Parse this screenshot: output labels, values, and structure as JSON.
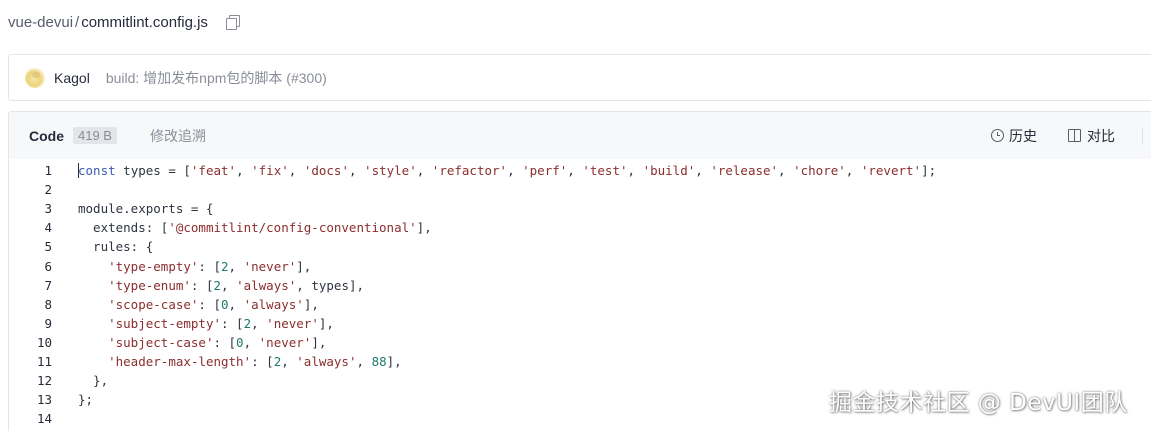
{
  "breadcrumb": {
    "repo": "vue-devui",
    "separator": "/",
    "file": "commitlint.config.js",
    "copy_icon": "copy-icon"
  },
  "commit": {
    "avatar_icon": "avatar-image",
    "author": "Kagol",
    "message": "build: 增加发布npm包的脚本 (#300)"
  },
  "file_header": {
    "tab_code": "Code",
    "size": "419 B",
    "tab_blame": "修改追溯",
    "history_label": "历史",
    "history_icon": "clock-icon",
    "compare_label": "对比",
    "compare_icon": "compare-icon"
  },
  "code": {
    "lines": [
      {
        "n": "1",
        "tokens": [
          [
            "kw",
            "const"
          ],
          [
            "p",
            " types = ["
          ],
          [
            "s",
            "'feat'"
          ],
          [
            "p",
            ", "
          ],
          [
            "s",
            "'fix'"
          ],
          [
            "p",
            ", "
          ],
          [
            "s",
            "'docs'"
          ],
          [
            "p",
            ", "
          ],
          [
            "s",
            "'style'"
          ],
          [
            "p",
            ", "
          ],
          [
            "s",
            "'refactor'"
          ],
          [
            "p",
            ", "
          ],
          [
            "s",
            "'perf'"
          ],
          [
            "p",
            ", "
          ],
          [
            "s",
            "'test'"
          ],
          [
            "p",
            ", "
          ],
          [
            "s",
            "'build'"
          ],
          [
            "p",
            ", "
          ],
          [
            "s",
            "'release'"
          ],
          [
            "p",
            ", "
          ],
          [
            "s",
            "'chore'"
          ],
          [
            "p",
            ", "
          ],
          [
            "s",
            "'revert'"
          ],
          [
            "p",
            "];"
          ]
        ]
      },
      {
        "n": "2",
        "tokens": []
      },
      {
        "n": "3",
        "tokens": [
          [
            "p",
            "module.exports = {"
          ]
        ]
      },
      {
        "n": "4",
        "tokens": [
          [
            "p",
            "  extends: ["
          ],
          [
            "s",
            "'@commitlint/config-conventional'"
          ],
          [
            "p",
            "],"
          ]
        ]
      },
      {
        "n": "5",
        "tokens": [
          [
            "p",
            "  rules: {"
          ]
        ]
      },
      {
        "n": "6",
        "tokens": [
          [
            "p",
            "    "
          ],
          [
            "s",
            "'type-empty'"
          ],
          [
            "p",
            ": ["
          ],
          [
            "n",
            "2"
          ],
          [
            "p",
            ", "
          ],
          [
            "s",
            "'never'"
          ],
          [
            "p",
            "],"
          ]
        ]
      },
      {
        "n": "7",
        "tokens": [
          [
            "p",
            "    "
          ],
          [
            "s",
            "'type-enum'"
          ],
          [
            "p",
            ": ["
          ],
          [
            "n",
            "2"
          ],
          [
            "p",
            ", "
          ],
          [
            "s",
            "'always'"
          ],
          [
            "p",
            ", types],"
          ]
        ]
      },
      {
        "n": "8",
        "tokens": [
          [
            "p",
            "    "
          ],
          [
            "s",
            "'scope-case'"
          ],
          [
            "p",
            ": ["
          ],
          [
            "n",
            "0"
          ],
          [
            "p",
            ", "
          ],
          [
            "s",
            "'always'"
          ],
          [
            "p",
            "],"
          ]
        ]
      },
      {
        "n": "9",
        "tokens": [
          [
            "p",
            "    "
          ],
          [
            "s",
            "'subject-empty'"
          ],
          [
            "p",
            ": ["
          ],
          [
            "n",
            "2"
          ],
          [
            "p",
            ", "
          ],
          [
            "s",
            "'never'"
          ],
          [
            "p",
            "],"
          ]
        ]
      },
      {
        "n": "10",
        "tokens": [
          [
            "p",
            "    "
          ],
          [
            "s",
            "'subject-case'"
          ],
          [
            "p",
            ": ["
          ],
          [
            "n",
            "0"
          ],
          [
            "p",
            ", "
          ],
          [
            "s",
            "'never'"
          ],
          [
            "p",
            "],"
          ]
        ]
      },
      {
        "n": "11",
        "tokens": [
          [
            "p",
            "    "
          ],
          [
            "s",
            "'header-max-length'"
          ],
          [
            "p",
            ": ["
          ],
          [
            "n",
            "2"
          ],
          [
            "p",
            ", "
          ],
          [
            "s",
            "'always'"
          ],
          [
            "p",
            ", "
          ],
          [
            "n",
            "88"
          ],
          [
            "p",
            "],"
          ]
        ]
      },
      {
        "n": "12",
        "tokens": [
          [
            "p",
            "  },"
          ]
        ]
      },
      {
        "n": "13",
        "tokens": [
          [
            "p",
            "};"
          ]
        ]
      },
      {
        "n": "14",
        "tokens": []
      }
    ]
  },
  "watermark": "掘金技术社区 @ DevUI团队",
  "colors": {
    "keyword": "#3d5ab3",
    "string": "#8b2e2e",
    "number": "#1d7b6d",
    "text": "#252b3a",
    "muted": "#8a8e99"
  }
}
